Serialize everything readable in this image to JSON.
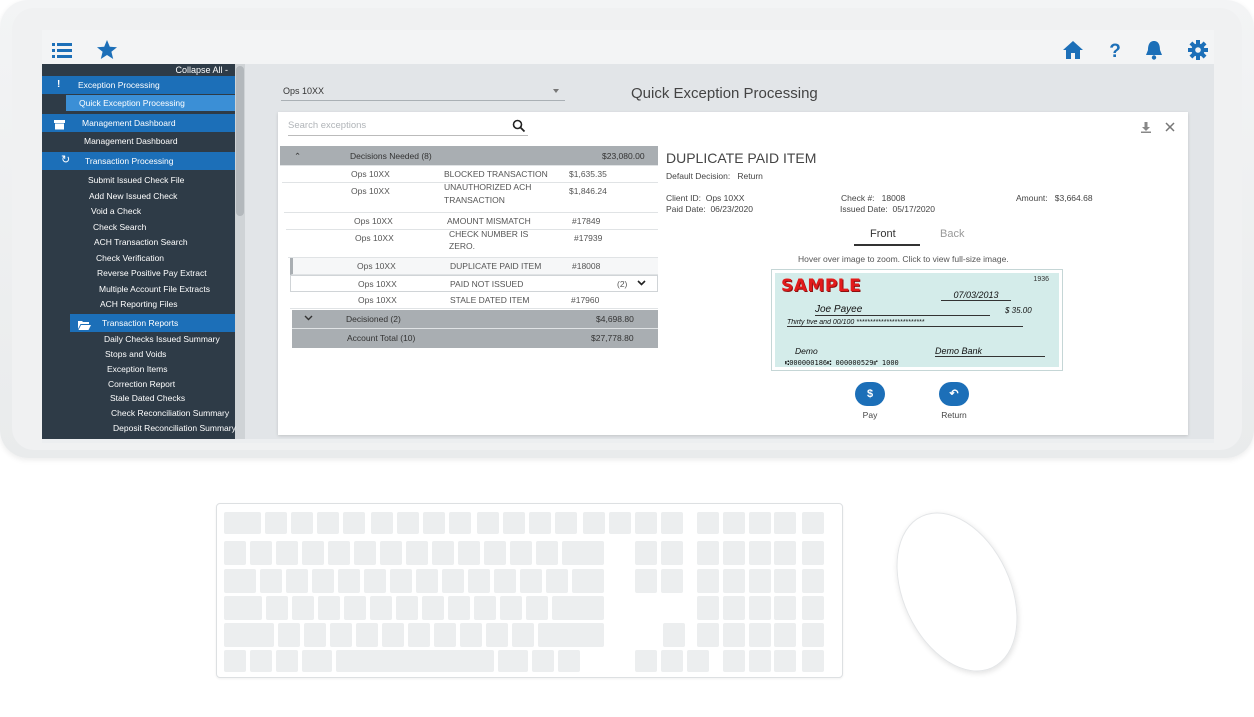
{
  "sidebar": {
    "collapse_label": "Collapse All -",
    "items": [
      {
        "label": "Exception Processing",
        "type": "section",
        "icon": "exclamation-icon"
      },
      {
        "label": "Quick Exception Processing",
        "type": "active"
      },
      {
        "label": "Management Dashboard",
        "type": "section",
        "icon": "archive-icon"
      },
      {
        "label": "Management Dashboard",
        "type": "item"
      },
      {
        "label": "Transaction Processing",
        "type": "section",
        "icon": "refresh-icon"
      },
      {
        "label": "Submit Issued Check File",
        "type": "item"
      },
      {
        "label": "Add New Issued Check",
        "type": "item"
      },
      {
        "label": "Void a Check",
        "type": "item"
      },
      {
        "label": "Check Search",
        "type": "item"
      },
      {
        "label": "ACH Transaction Search",
        "type": "item"
      },
      {
        "label": "Check Verification",
        "type": "item"
      },
      {
        "label": "Reverse Positive Pay Extract",
        "type": "item"
      },
      {
        "label": "Multiple Account File Extracts",
        "type": "item"
      },
      {
        "label": "ACH Reporting Files",
        "type": "item"
      },
      {
        "label": "Transaction Reports",
        "type": "section",
        "icon": "folder-open-icon"
      },
      {
        "label": "Daily Checks Issued Summary",
        "type": "item"
      },
      {
        "label": "Stops and Voids",
        "type": "item"
      },
      {
        "label": "Exception Items",
        "type": "item"
      },
      {
        "label": "Correction Report",
        "type": "item"
      },
      {
        "label": "Stale Dated Checks",
        "type": "item"
      },
      {
        "label": "Check Reconciliation Summary",
        "type": "item"
      },
      {
        "label": "Deposit Reconciliation Summary",
        "type": "item"
      }
    ]
  },
  "topbar": {
    "icons": [
      "list-icon",
      "star-icon",
      "home-icon",
      "help-icon",
      "bell-icon",
      "gear-icon"
    ],
    "accent": "#1c6fb8"
  },
  "main": {
    "account_select": "Ops 10XX",
    "title": "Quick Exception Processing",
    "search_placeholder": "Search exceptions"
  },
  "exceptions": {
    "needed_header": {
      "label": "Decisions Needed (8)",
      "amount": "$23,080.00"
    },
    "rows": [
      {
        "account": "Ops 10XX",
        "type": "BLOCKED TRANSACTION",
        "value": "$1,635.35"
      },
      {
        "account": "Ops 10XX",
        "type": "UNAUTHORIZED ACH",
        "type2": "TRANSACTION",
        "value": "$1,846.24"
      },
      {
        "account": "Ops 10XX",
        "type": "AMOUNT MISMATCH",
        "value": "#17849"
      },
      {
        "account": "Ops 10XX",
        "type": "CHECK NUMBER IS",
        "type2": "ZERO.",
        "value": "#17939"
      },
      {
        "account": "Ops 10XX",
        "type": "DUPLICATE PAID ITEM",
        "value": "#18008"
      },
      {
        "account": "Ops 10XX",
        "type": "PAID NOT ISSUED",
        "value": "(2)"
      },
      {
        "account": "Ops 10XX",
        "type": "STALE DATED ITEM",
        "value": "#17960"
      }
    ],
    "decisioned": {
      "label": "Decisioned (2)",
      "amount": "$4,698.80"
    },
    "total": {
      "label": "Account Total (10)",
      "amount": "$27,778.80"
    }
  },
  "detail": {
    "title": "DUPLICATE PAID ITEM",
    "default_decision_label": "Default Decision:",
    "default_decision": "Return",
    "client_id_label": "Client ID:",
    "client_id": "Ops 10XX",
    "paid_date_label": "Paid Date:",
    "paid_date": "06/23/2020",
    "check_no_label": "Check #:",
    "check_no": "18008",
    "issued_date_label": "Issued Date:",
    "issued_date": "05/17/2020",
    "amount_label": "Amount:",
    "amount": "$3,664.68",
    "tab_front": "Front",
    "tab_back": "Back",
    "hint": "Hover over image to zoom. Click to view full-size image.",
    "pay_label": "Pay",
    "return_label": "Return"
  },
  "check_image": {
    "sample": "SAMPLE",
    "number": "1936",
    "date": "07/03/2013",
    "payee": "Joe Payee",
    "amount": "$ 35.00",
    "words": "Thirty five and 00/100 *************************",
    "memo": "Demo",
    "bank": "Demo Bank",
    "micr": "⑆000000186⑆  000000529⑈  1000"
  }
}
